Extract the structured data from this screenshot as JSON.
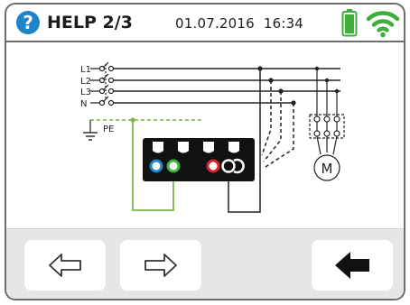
{
  "header": {
    "help_icon_glyph": "?",
    "title": "HELP 2/3",
    "date": "01.07.2016",
    "time": "16:34",
    "battery_icon": "battery-full-icon",
    "wifi_icon": "wifi-icon",
    "battery_color": "#3fae3a",
    "wifi_color": "#3fae3a",
    "help_color": "#1e83c8"
  },
  "diagram": {
    "line_labels": [
      "L1",
      "L2",
      "L3",
      "N"
    ],
    "pe_label": "PE",
    "motor_label": "M",
    "terminal_colors": [
      "#1e83c8",
      "#3fae3a",
      "#d8262e",
      "#ffffff"
    ],
    "pe_line_color": "#7ab648"
  },
  "footer": {
    "prev_icon": "arrow-left-outline-icon",
    "next_icon": "arrow-right-outline-icon",
    "back_icon": "arrow-left-solid-icon"
  }
}
